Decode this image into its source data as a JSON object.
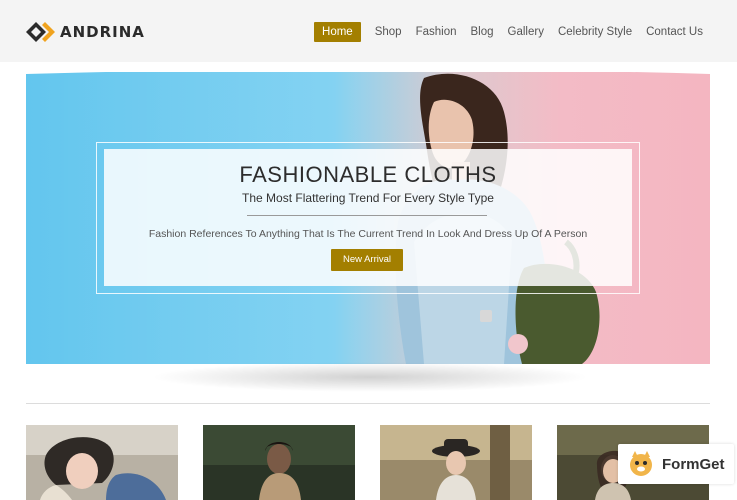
{
  "brand": {
    "name": "ANDRINA"
  },
  "nav": {
    "items": [
      {
        "label": "Home",
        "active": true
      },
      {
        "label": "Shop",
        "active": false
      },
      {
        "label": "Fashion",
        "active": false
      },
      {
        "label": "Blog",
        "active": false
      },
      {
        "label": "Gallery",
        "active": false
      },
      {
        "label": "Celebrity Style",
        "active": false
      },
      {
        "label": "Contact Us",
        "active": false
      }
    ]
  },
  "hero": {
    "title": "FASHIONABLE CLOTHS",
    "subtitle": "The Most Flattering Trend For Every Style Type",
    "text": "Fashion References To Anything That Is The Current Trend In Look And Dress Up Of A Person",
    "button_label": "New Arrival"
  },
  "gallery": {
    "count": 4
  },
  "badge": {
    "label": "FormGet"
  },
  "colors": {
    "accent": "#a37f00",
    "hero_blue": "#63c6ee",
    "hero_pink": "#f4b6c1"
  }
}
